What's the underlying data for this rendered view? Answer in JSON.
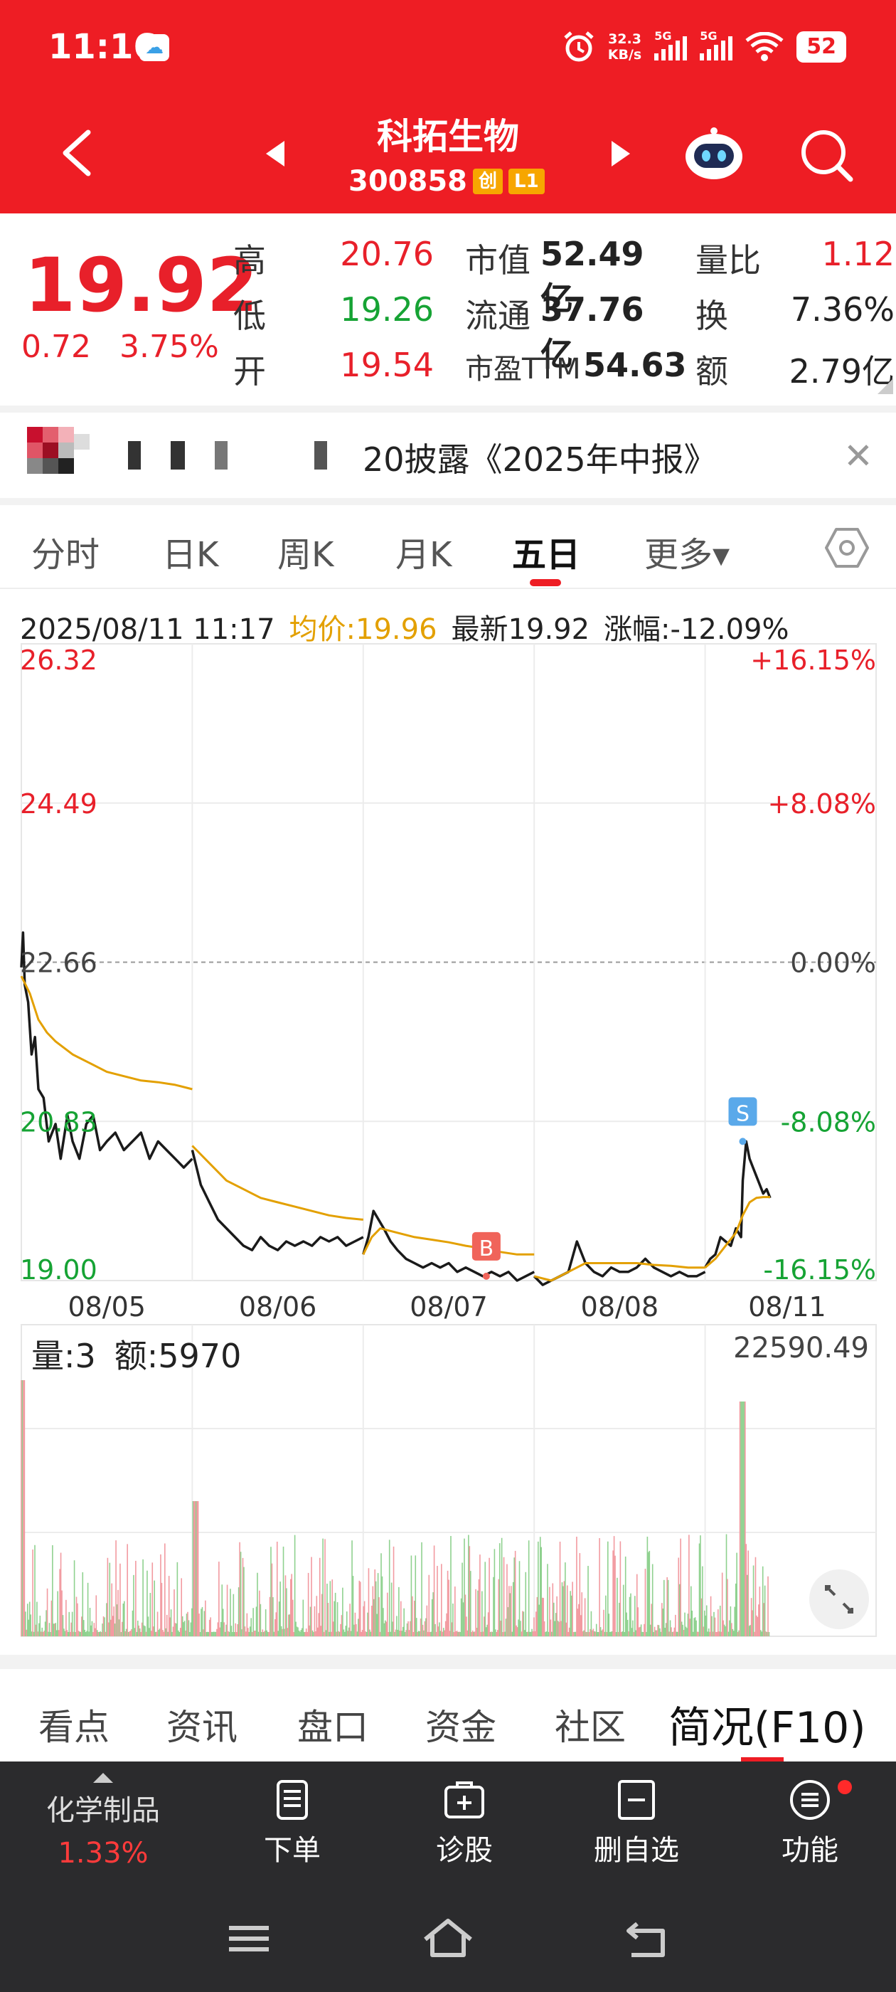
{
  "status_bar": {
    "time": "11:16",
    "net_speed_top": "32.3",
    "net_speed_bottom": "KB/s",
    "sim1": "5G",
    "sim2": "5G",
    "battery": "52"
  },
  "header": {
    "title": "科拓生物",
    "code": "300858",
    "tag_chuang": "创",
    "tag_level": "L1"
  },
  "quote": {
    "price": "19.92",
    "change": "0.72",
    "change_pct": "3.75%",
    "rows": [
      {
        "l1": "高",
        "v1": "20.76",
        "l2": "市值",
        "v2": "52.49亿",
        "l3": "量比",
        "v3": "1.12"
      },
      {
        "l1": "低",
        "v1": "19.26",
        "l2": "流通",
        "v2": "37.76亿",
        "l3": "换",
        "v3": "7.36%"
      },
      {
        "l1": "开",
        "v1": "19.54",
        "l2": "市盈TTM",
        "v2": "54.63",
        "l3": "额",
        "v3": "2.79亿"
      }
    ]
  },
  "notice": {
    "text": "20披露《2025年中报》"
  },
  "period_tabs": [
    "分时",
    "日K",
    "周K",
    "月K",
    "五日",
    "更多▾"
  ],
  "chart_info": {
    "datetime": "2025/08/11 11:17",
    "avg": "均价:19.96",
    "latest": "最新19.92",
    "change": "涨幅:-12.09%"
  },
  "chart_data": {
    "type": "line",
    "title": "",
    "x_labels": [
      "08/05",
      "08/06",
      "08/07",
      "08/08",
      "08/11"
    ],
    "ylim": [
      19.0,
      26.32
    ],
    "y_ticks_left": [
      "26.32",
      "24.49",
      "22.66",
      "20.83",
      "19.00"
    ],
    "y_ticks_right": [
      "+16.15%",
      "+8.08%",
      "0.00%",
      "-8.08%",
      "-16.15%"
    ],
    "reference": 22.66,
    "markers": [
      {
        "label": "B",
        "day": "08/07",
        "price": 19.05
      },
      {
        "label": "S",
        "day": "08/11",
        "price": 20.6
      }
    ],
    "series": [
      {
        "color": "#1a1a1a",
        "values": [
          [
            0,
            22.6
          ],
          [
            0.01,
            23.0
          ],
          [
            0.02,
            22.4
          ],
          [
            0.04,
            22.2
          ],
          [
            0.06,
            21.6
          ],
          [
            0.08,
            21.8
          ],
          [
            0.1,
            21.2
          ],
          [
            0.13,
            21.1
          ],
          [
            0.16,
            20.6
          ],
          [
            0.2,
            20.8
          ],
          [
            0.23,
            20.4
          ],
          [
            0.27,
            20.9
          ],
          [
            0.3,
            20.6
          ],
          [
            0.34,
            20.4
          ],
          [
            0.38,
            20.8
          ],
          [
            0.42,
            20.9
          ],
          [
            0.46,
            20.5
          ],
          [
            0.5,
            20.6
          ],
          [
            0.55,
            20.7
          ],
          [
            0.6,
            20.5
          ],
          [
            0.65,
            20.6
          ],
          [
            0.7,
            20.7
          ],
          [
            0.75,
            20.4
          ],
          [
            0.8,
            20.6
          ],
          [
            0.85,
            20.5
          ],
          [
            0.9,
            20.4
          ],
          [
            0.95,
            20.3
          ],
          [
            1.0,
            20.4
          ],
          [
            1.0,
            20.5
          ],
          [
            1.05,
            20.1
          ],
          [
            1.1,
            19.9
          ],
          [
            1.15,
            19.7
          ],
          [
            1.2,
            19.6
          ],
          [
            1.25,
            19.5
          ],
          [
            1.3,
            19.4
          ],
          [
            1.35,
            19.35
          ],
          [
            1.4,
            19.5
          ],
          [
            1.45,
            19.4
          ],
          [
            1.5,
            19.35
          ],
          [
            1.55,
            19.45
          ],
          [
            1.6,
            19.4
          ],
          [
            1.65,
            19.45
          ],
          [
            1.7,
            19.4
          ],
          [
            1.75,
            19.5
          ],
          [
            1.8,
            19.45
          ],
          [
            1.85,
            19.5
          ],
          [
            1.9,
            19.4
          ],
          [
            1.95,
            19.45
          ],
          [
            2.0,
            19.5
          ],
          [
            2.0,
            19.3
          ],
          [
            2.03,
            19.5
          ],
          [
            2.06,
            19.8
          ],
          [
            2.09,
            19.7
          ],
          [
            2.12,
            19.6
          ],
          [
            2.16,
            19.45
          ],
          [
            2.2,
            19.35
          ],
          [
            2.25,
            19.25
          ],
          [
            2.3,
            19.2
          ],
          [
            2.35,
            19.15
          ],
          [
            2.4,
            19.2
          ],
          [
            2.45,
            19.15
          ],
          [
            2.5,
            19.2
          ],
          [
            2.55,
            19.1
          ],
          [
            2.6,
            19.15
          ],
          [
            2.65,
            19.1
          ],
          [
            2.7,
            19.05
          ],
          [
            2.75,
            19.1
          ],
          [
            2.8,
            19.05
          ],
          [
            2.85,
            19.1
          ],
          [
            2.9,
            19.0
          ],
          [
            2.95,
            19.05
          ],
          [
            3.0,
            19.1
          ],
          [
            3.0,
            19.05
          ],
          [
            3.05,
            18.95
          ],
          [
            3.1,
            19.0
          ],
          [
            3.15,
            19.05
          ],
          [
            3.2,
            19.1
          ],
          [
            3.25,
            19.45
          ],
          [
            3.3,
            19.2
          ],
          [
            3.35,
            19.1
          ],
          [
            3.4,
            19.05
          ],
          [
            3.45,
            19.15
          ],
          [
            3.5,
            19.1
          ],
          [
            3.55,
            19.1
          ],
          [
            3.6,
            19.15
          ],
          [
            3.65,
            19.25
          ],
          [
            3.7,
            19.15
          ],
          [
            3.75,
            19.1
          ],
          [
            3.8,
            19.05
          ],
          [
            3.85,
            19.1
          ],
          [
            3.9,
            19.05
          ],
          [
            3.95,
            19.05
          ],
          [
            4.0,
            19.1
          ],
          [
            4.0,
            19.15
          ],
          [
            4.03,
            19.25
          ],
          [
            4.06,
            19.3
          ],
          [
            4.09,
            19.5
          ],
          [
            4.12,
            19.45
          ],
          [
            4.15,
            19.4
          ],
          [
            4.18,
            19.6
          ],
          [
            4.21,
            19.5
          ],
          [
            4.22,
            20.15
          ],
          [
            4.24,
            20.6
          ],
          [
            4.26,
            20.4
          ],
          [
            4.28,
            20.3
          ],
          [
            4.3,
            20.2
          ],
          [
            4.32,
            20.1
          ],
          [
            4.34,
            20.0
          ],
          [
            4.36,
            20.05
          ],
          [
            4.38,
            19.95
          ]
        ]
      },
      {
        "color": "#e3a000",
        "values": [
          [
            0,
            22.5
          ],
          [
            0.05,
            22.3
          ],
          [
            0.1,
            22.0
          ],
          [
            0.15,
            21.85
          ],
          [
            0.2,
            21.75
          ],
          [
            0.3,
            21.6
          ],
          [
            0.4,
            21.5
          ],
          [
            0.5,
            21.4
          ],
          [
            0.6,
            21.35
          ],
          [
            0.7,
            21.3
          ],
          [
            0.8,
            21.28
          ],
          [
            0.9,
            21.25
          ],
          [
            1.0,
            21.2
          ],
          [
            1.0,
            20.55
          ],
          [
            1.1,
            20.35
          ],
          [
            1.2,
            20.15
          ],
          [
            1.3,
            20.05
          ],
          [
            1.4,
            19.95
          ],
          [
            1.5,
            19.9
          ],
          [
            1.6,
            19.85
          ],
          [
            1.7,
            19.8
          ],
          [
            1.8,
            19.75
          ],
          [
            1.9,
            19.72
          ],
          [
            2.0,
            19.7
          ],
          [
            2.0,
            19.3
          ],
          [
            2.05,
            19.5
          ],
          [
            2.1,
            19.6
          ],
          [
            2.2,
            19.55
          ],
          [
            2.3,
            19.5
          ],
          [
            2.4,
            19.47
          ],
          [
            2.5,
            19.44
          ],
          [
            2.6,
            19.4
          ],
          [
            2.7,
            19.37
          ],
          [
            2.8,
            19.33
          ],
          [
            2.9,
            19.3
          ],
          [
            3.0,
            19.3
          ],
          [
            3.0,
            19.05
          ],
          [
            3.1,
            19.0
          ],
          [
            3.2,
            19.1
          ],
          [
            3.3,
            19.2
          ],
          [
            3.4,
            19.2
          ],
          [
            3.5,
            19.2
          ],
          [
            3.6,
            19.2
          ],
          [
            3.7,
            19.18
          ],
          [
            3.8,
            19.17
          ],
          [
            3.9,
            19.15
          ],
          [
            4.0,
            19.15
          ],
          [
            4.0,
            19.15
          ],
          [
            4.06,
            19.25
          ],
          [
            4.12,
            19.4
          ],
          [
            4.18,
            19.55
          ],
          [
            4.22,
            19.75
          ],
          [
            4.26,
            19.9
          ],
          [
            4.3,
            19.95
          ],
          [
            4.34,
            19.96
          ],
          [
            4.38,
            19.96
          ]
        ]
      }
    ]
  },
  "volume": {
    "label": "量:3",
    "amount": "额:5970",
    "max": "22590.49"
  },
  "bottom_tabs": [
    "看点",
    "资讯",
    "盘口",
    "资金",
    "社区",
    "简况(F10)"
  ],
  "toolbar": {
    "sector_name": "化学制品",
    "sector_pct": "1.33%",
    "order": "下单",
    "diagnose": "诊股",
    "remove_watch": "删自选",
    "functions": "功能"
  }
}
